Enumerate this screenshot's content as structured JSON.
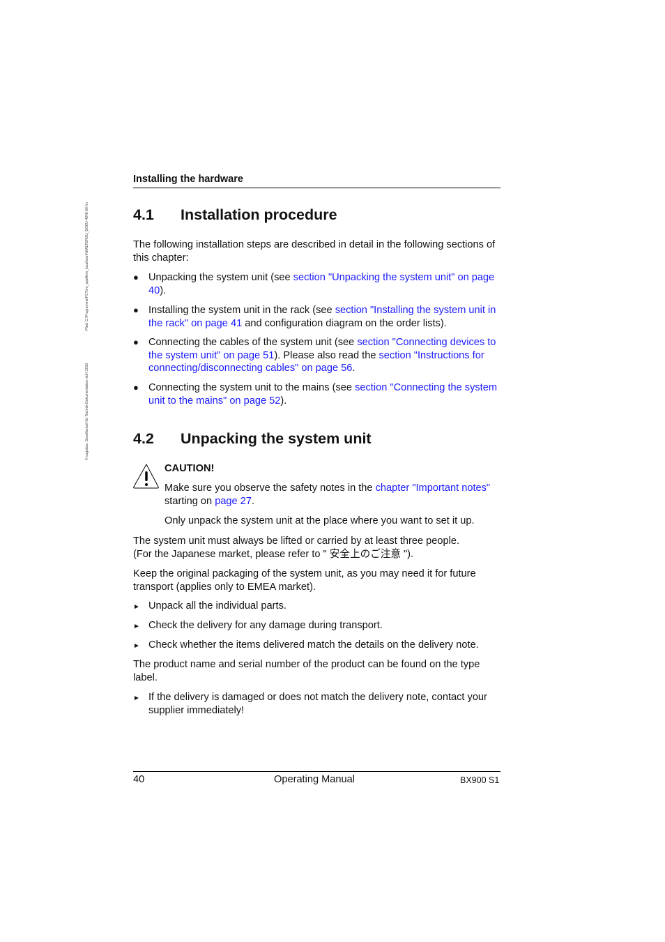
{
  "sidebar": {
    "file_path": "Pfad: C:\\Programme\\FCTirm_appl\\tirm_local\\work\\WALTERGU_DOKU-4848-00.fm",
    "copyright": "© cognitas. Gesellschaft für Technik-Dokumentation mbH 2010"
  },
  "header": {
    "running_title": "Installing the hardware"
  },
  "section_4_1": {
    "number": "4.1",
    "title": "Installation procedure",
    "intro": "The following installation steps are described in detail in the following sections of this chapter:",
    "bullets": [
      {
        "parts": [
          {
            "text": "Unpacking the system unit (see ",
            "link": false
          },
          {
            "text": "section \"Unpacking the system unit\" on page 40",
            "link": true
          },
          {
            "text": ").",
            "link": false
          }
        ]
      },
      {
        "parts": [
          {
            "text": "Installing the system unit in the rack (see ",
            "link": false
          },
          {
            "text": "section \"Installing the system unit in the rack\" on page 41",
            "link": true
          },
          {
            "text": " and configuration diagram on the order lists).",
            "link": false
          }
        ]
      },
      {
        "parts": [
          {
            "text": "Connecting the cables of the system unit (see ",
            "link": false
          },
          {
            "text": "section \"Connecting devices to the system unit\" on page 51",
            "link": true
          },
          {
            "text": "). Please also read the ",
            "link": false
          },
          {
            "text": "section \"Instructions for connecting/disconnecting cables\" on page 56",
            "link": true
          },
          {
            "text": ".",
            "link": false
          }
        ]
      },
      {
        "parts": [
          {
            "text": "Connecting the system unit to the mains (see ",
            "link": false
          },
          {
            "text": "section \"Connecting the system unit to the mains\" on page 52",
            "link": true
          },
          {
            "text": ").",
            "link": false
          }
        ]
      }
    ]
  },
  "section_4_2": {
    "number": "4.2",
    "title": "Unpacking the system unit",
    "caution": {
      "label": "CAUTION!",
      "text_before": "Make sure you observe the safety notes in the ",
      "link1": "chapter \"Important notes\"",
      "text_mid": " starting on ",
      "link2": "page 27",
      "text_after": ".",
      "note": "Only unpack the system unit at the place where you want to set it up."
    },
    "lifting_line1": "The system unit must always be lifted or carried by at least three people.",
    "lifting_line2": "(For the Japanese market, please refer to \" 安全上のご注意 \").",
    "packaging": "Keep the original packaging of the system unit, as you may need it for future transport (applies only to EMEA market).",
    "steps": [
      "Unpack all the individual parts.",
      "Check the delivery for any damage during transport.",
      "Check whether the items delivered match the details on the delivery note."
    ],
    "type_label": "The product name and serial number of the product can be found on the type label.",
    "final_step": "If the delivery is damaged or does not match the delivery note, contact your supplier immediately!"
  },
  "footer": {
    "page_number": "40",
    "manual_title": "Operating Manual",
    "product": "BX900 S1"
  },
  "icons": {
    "bullet": "●",
    "arrow": "►"
  }
}
